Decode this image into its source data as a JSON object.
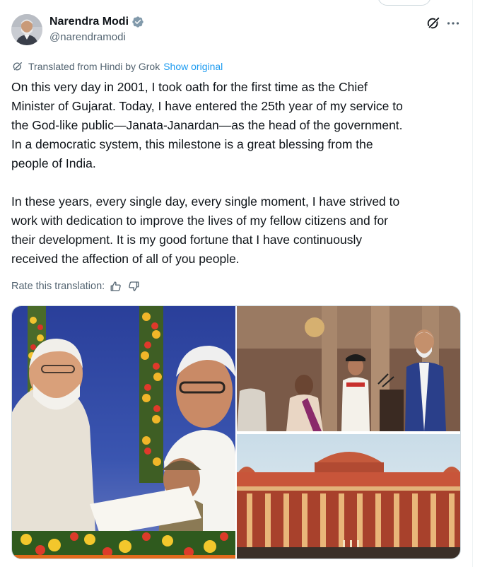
{
  "author": {
    "name": "Narendra Modi",
    "handle": "@narendramodi",
    "verified": true
  },
  "icons": {
    "verified": "verified-badge-icon",
    "grok": "grok-icon",
    "more": "more-icon",
    "translate": "translate-icon",
    "like": "thumbs-up-icon",
    "dislike": "thumbs-down-icon"
  },
  "translation": {
    "label": "Translated from Hindi by Grok",
    "show_original": "Show original",
    "rate_label": "Rate this translation:"
  },
  "tweet": {
    "paragraph1": "On this very day in 2001, I took oath for the first time as the Chief\nMinister of Gujarat. Today, I have entered the 25th year of my service to\nthe God-like public—Janata-Janardan—as the head of the government.\nIn a democratic system, this milestone is a great blessing from the\npeople of India.",
    "paragraph2": "In these years, every single day, every single moment, I have strived to\nwork with dedication to improve the lives of my fellow citizens and for\ntheir development. It is my good fortune that I have continuously\nreceived the affection of all of you people."
  },
  "colors": {
    "text": "#0f1419",
    "secondary": "#536471",
    "link": "#1d9bf0",
    "verified": "#829aab"
  }
}
